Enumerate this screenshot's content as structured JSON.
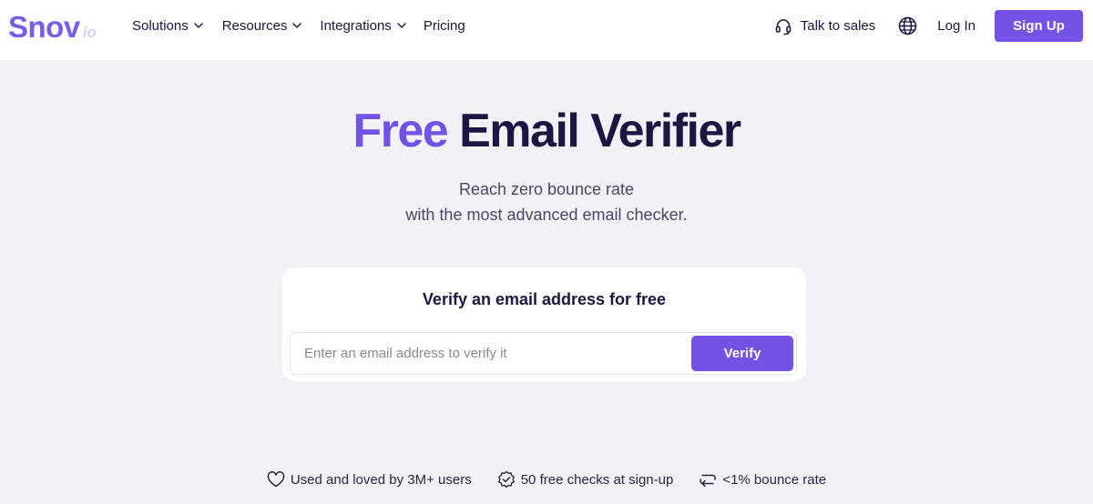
{
  "brand": {
    "name": "Snov",
    "suffix": "io"
  },
  "nav": {
    "items": [
      {
        "label": "Solutions",
        "has_dropdown": true
      },
      {
        "label": "Resources",
        "has_dropdown": true
      },
      {
        "label": "Integrations",
        "has_dropdown": true
      },
      {
        "label": "Pricing",
        "has_dropdown": false
      }
    ],
    "talk_to_sales": "Talk to sales",
    "login": "Log In",
    "signup": "Sign Up"
  },
  "hero": {
    "title_accent": "Free",
    "title_rest": "Email Verifier",
    "subtitle_line1": "Reach zero bounce rate",
    "subtitle_line2": "with the most advanced email checker."
  },
  "verify_card": {
    "title": "Verify an email address for free",
    "input_placeholder": "Enter an email address to verify it",
    "input_value": "",
    "button_label": "Verify"
  },
  "features": [
    {
      "icon": "heart-icon",
      "text": "Used and loved by 3M+ users"
    },
    {
      "icon": "check-badge-icon",
      "text": "50 free checks at sign-up"
    },
    {
      "icon": "return-arrow-icon",
      "text": "<1% bounce rate"
    }
  ],
  "colors": {
    "accent": "#7452e6",
    "heading": "#1f1543",
    "background": "#f2f2f6",
    "logo_sub": "#d9d0f7"
  }
}
